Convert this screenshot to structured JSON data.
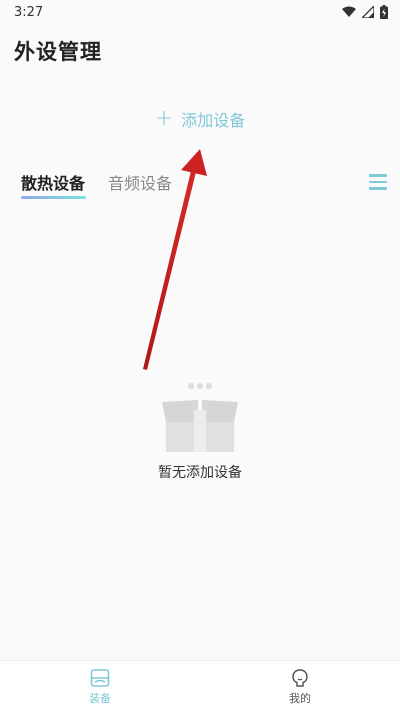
{
  "status_bar": {
    "time": "3:27",
    "icons": [
      "wifi-icon",
      "signal-icon",
      "battery-icon"
    ]
  },
  "header": {
    "title": "外设管理"
  },
  "add_device": {
    "icon": "plus-icon",
    "label": "添加设备"
  },
  "tabs": [
    {
      "label": "散热设备",
      "active": true
    },
    {
      "label": "音频设备",
      "active": false
    }
  ],
  "menu_icon": "menu-icon",
  "empty_state": {
    "icon": "empty-box-icon",
    "text": "暂无添加设备"
  },
  "bottom_nav": [
    {
      "label": "装备",
      "icon": "equipment-icon",
      "active": true
    },
    {
      "label": "我的",
      "icon": "profile-icon",
      "active": false
    }
  ],
  "colors": {
    "accent": "#7ec8d8",
    "arrow": "#cc2222",
    "tab_gradient_start": "#8fa8e8",
    "tab_gradient_end": "#7fe0d8"
  }
}
